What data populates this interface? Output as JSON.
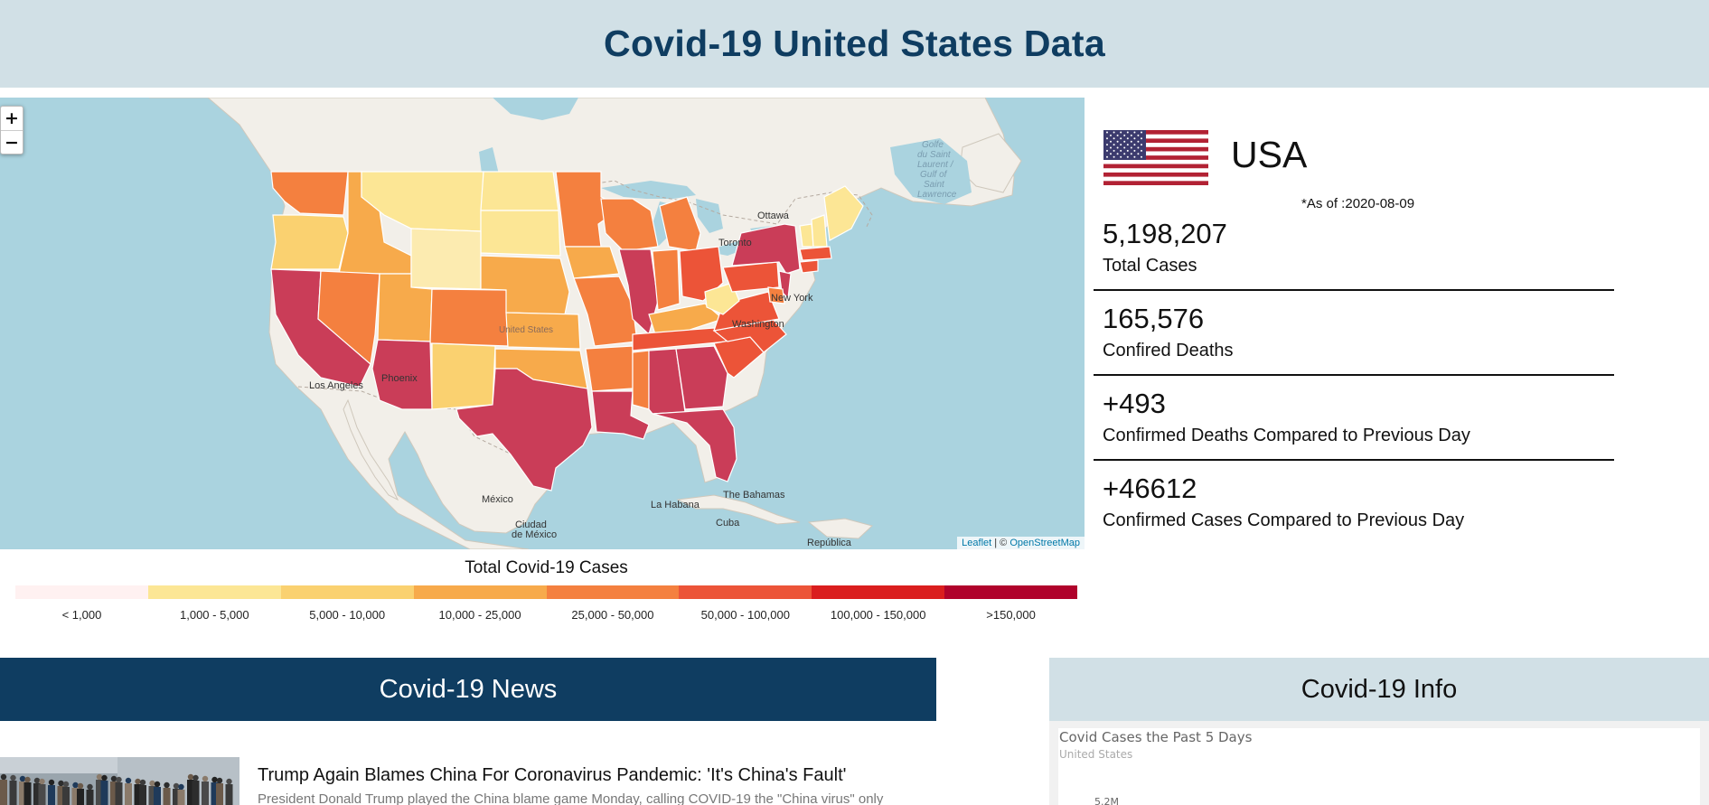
{
  "header": {
    "title": "Covid-19 United States Data"
  },
  "map": {
    "zoom_in": "+",
    "zoom_out": "−",
    "attribution_leaflet": "Leaflet",
    "attribution_sep": " | © ",
    "attribution_osm": "OpenStreetMap",
    "place_labels": {
      "gulf": [
        "Golfe",
        "du Saint",
        "Laurent /",
        "Gulf of",
        "Saint",
        "Lawrence"
      ],
      "ottawa": "Ottawa",
      "toronto": "Toronto",
      "new_york": "New York",
      "washington": "Washington",
      "los_angeles": "Los Angeles",
      "phoenix": "Phoenix",
      "united_states": "United States",
      "mexico": "México",
      "ciudad_de_mexico": [
        "Ciudad",
        "de México"
      ],
      "la_habana": "La Habana",
      "the_bahamas": "The Bahamas",
      "cuba": "Cuba",
      "republica": "República"
    }
  },
  "legend": {
    "title": "Total Covid-19 Cases",
    "bins": [
      {
        "label": "< 1,000",
        "color": "#fff1f1"
      },
      {
        "label": "1,000 - 5,000",
        "color": "#fce695"
      },
      {
        "label": "5,000 - 10,000",
        "color": "#fad170"
      },
      {
        "label": "10,000 - 25,000",
        "color": "#f7aa4b"
      },
      {
        "label": "25,000 - 50,000",
        "color": "#f4803f"
      },
      {
        "label": "50,000 - 100,000",
        "color": "#ec5438"
      },
      {
        "label": "100,000 - 150,000",
        "color": "#da1e1e"
      },
      {
        "label": ">150,000",
        "color": "#b0022b"
      }
    ]
  },
  "stats": {
    "country": "USA",
    "as_of": "*As of :2020-08-09",
    "total_cases": {
      "value": "5,198,207",
      "label": "Total Cases"
    },
    "deaths": {
      "value": "165,576",
      "label": "Confired Deaths"
    },
    "new_deaths": {
      "value": "+493",
      "label": "Confirmed Deaths Compared to Previous Day"
    },
    "new_cases": {
      "value": "+46612",
      "label": "Confirmed Cases Compared to Previous Day"
    }
  },
  "news": {
    "header": "Covid-19 News",
    "items": [
      {
        "title": "Trump Again Blames China For Coronavirus Pandemic: 'It's China's Fault'",
        "summary": "President Donald Trump played the China blame game Monday, calling COVID-19 the \"China virus\" only"
      }
    ]
  },
  "info": {
    "header": "Covid-19 Info",
    "chart": {
      "title": "Covid Cases the Past 5 Days",
      "subtitle": "United States",
      "tick_label": "5.2M"
    }
  }
}
